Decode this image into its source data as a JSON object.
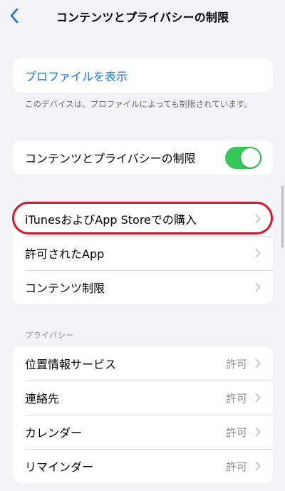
{
  "nav": {
    "title": "コンテンツとプライバシーの制限",
    "back_icon": "chevron-left-icon"
  },
  "profile": {
    "link_label": "プロファイルを表示",
    "footnote": "このデバイスは、プロファイルによっても制限されています。"
  },
  "restrictions_toggle": {
    "label": "コンテンツとプライバシーの制限",
    "on": true
  },
  "store_group": {
    "items": [
      {
        "label": "iTunesおよびApp Storeでの購入"
      },
      {
        "label": "許可されたApp"
      },
      {
        "label": "コンテンツ制限"
      }
    ]
  },
  "privacy": {
    "header": "プライバシー",
    "items": [
      {
        "label": "位置情報サービス",
        "value": "許可"
      },
      {
        "label": "連絡先",
        "value": "許可"
      },
      {
        "label": "カレンダー",
        "value": "許可"
      },
      {
        "label": "リマインダー",
        "value": "許可"
      }
    ]
  },
  "colors": {
    "accent": "#1a73d9",
    "toggle_on": "#34c759",
    "highlight": "#d6182b",
    "background": "#f2f2f7"
  }
}
